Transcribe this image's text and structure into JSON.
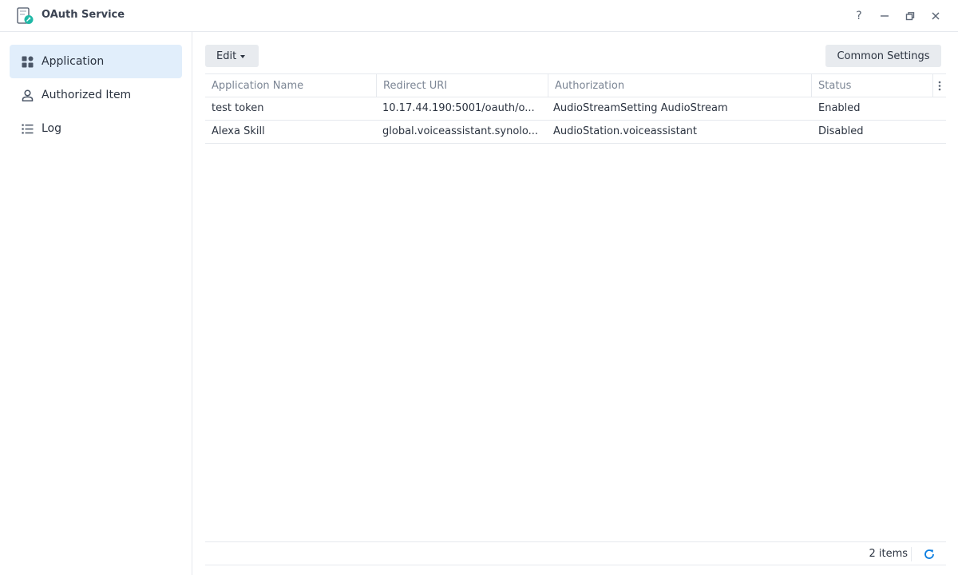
{
  "window": {
    "title": "OAuth Service",
    "help_symbol": "?"
  },
  "sidebar": {
    "items": [
      {
        "label": "Application",
        "icon": "grid-icon",
        "active": true
      },
      {
        "label": "Authorized Item",
        "icon": "user-icon",
        "active": false
      },
      {
        "label": "Log",
        "icon": "list-icon",
        "active": false
      }
    ]
  },
  "toolbar": {
    "edit_label": "Edit",
    "common_settings_label": "Common Settings"
  },
  "table": {
    "columns": [
      "Application Name",
      "Redirect URI",
      "Authorization",
      "Status"
    ],
    "rows": [
      {
        "name": "test token",
        "uri": "10.17.44.190:5001/oauth/o...",
        "authorization": "AudioStreamSetting AudioStream",
        "status": "Enabled"
      },
      {
        "name": "Alexa Skill",
        "uri": "global.voiceassistant.synolo...",
        "authorization": "AudioStation.voiceassistant",
        "status": "Disabled"
      }
    ]
  },
  "footer": {
    "item_count": "2 items"
  },
  "colors": {
    "accent": "#0a7de0",
    "active_bg": "#e1eefb",
    "border": "#e6e9ee"
  }
}
